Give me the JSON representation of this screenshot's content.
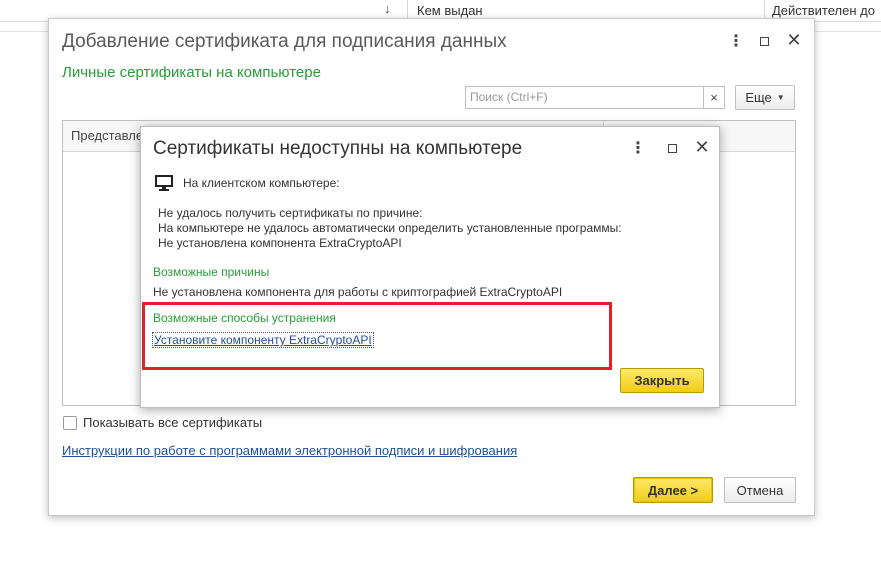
{
  "background_table": {
    "sort_arrow": "↓",
    "col_issued_by": "Кем выдан",
    "col_valid_until": "Действителен до"
  },
  "main_dialog": {
    "title": "Добавление сертификата для подписания данных",
    "subtitle": "Личные сертификаты на компьютере",
    "search_placeholder": "Поиск (Ctrl+F)",
    "search_clear": "×",
    "more_button": "Еще",
    "table_header": "Представле",
    "show_all_checkbox": "Показывать все сертификаты",
    "instructions_link": "Инструкции по работе с программами электронной подписи и шифрования",
    "next_button": "Далее >",
    "cancel_button": "Отмена"
  },
  "inner_dialog": {
    "title": "Сертификаты недоступны на компьютере",
    "client_label": "На клиентском компьютере:",
    "reason_line1": "Не удалось получить сертификаты по причине:",
    "reason_line2": "На компьютере не удалось автоматически определить установленные программы:",
    "reason_line3": "Не установлена компонента ExtraCryptoAPI",
    "possible_causes_heading": "Возможные причины",
    "possible_cause": "Не установлена компонента для работы с криптографией ExtraCryptoAPI",
    "fixes_heading": "Возможные способы устранения",
    "install_link": "Установите компоненту ExtraCryptoAPI",
    "close_button": "Закрыть"
  },
  "icons": {
    "kebab": "⋮",
    "close": "✕"
  },
  "colors": {
    "accent_green": "#2a9c3a",
    "link_blue": "#1f4f9e",
    "primary_button": "#f3cc16",
    "highlight_red": "#e3202b"
  }
}
